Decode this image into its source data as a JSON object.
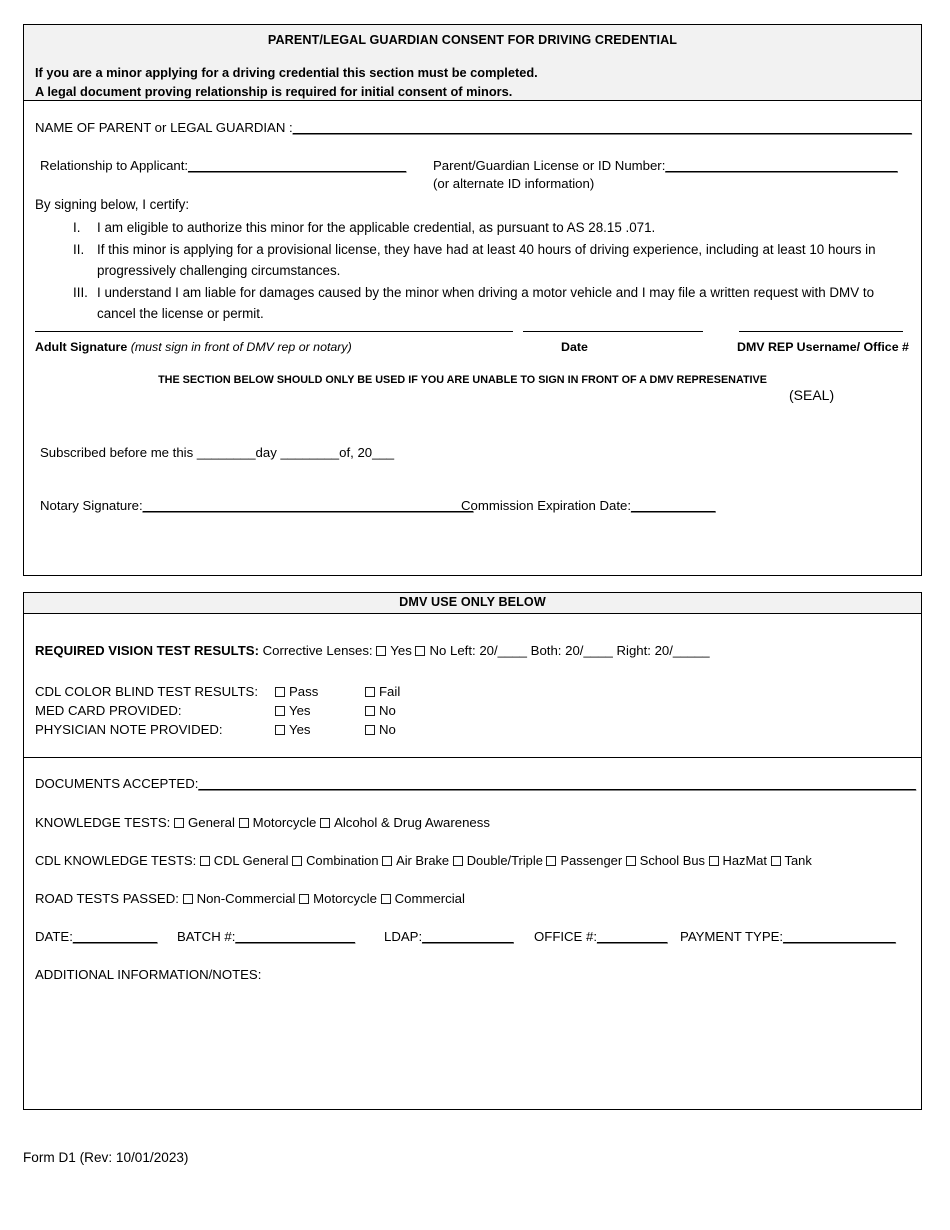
{
  "consent": {
    "title": "PARENT/LEGAL GUARDIAN CONSENT FOR DRIVING CREDENTIAL",
    "notice_line1": "If you are a minor applying for a driving credential this section must be completed.",
    "notice_line2": "A legal document proving relationship is required for initial consent of minors.",
    "name_label": "NAME OF PARENT or  LEGAL GUARDIAN :",
    "name_rule": "________________________________________________________________________________________",
    "relationship_label": "Relationship to Applicant:",
    "relationship_rule": "_______________________________",
    "license_label": "Parent/Guardian License or ID Number:",
    "license_rule": "_________________________________",
    "alternate_id_note": "(or alternate ID information)",
    "certify_intro": "By signing below, I certify:",
    "items": [
      {
        "num": "I.",
        "text": "I am eligible to authorize this minor for the applicable credential, as pursuant to AS 28.15 .071."
      },
      {
        "num": "II.",
        "text": "If this minor is applying for a provisional license, they have had at least 40 hours of driving experience, including at least 10 hours in progressively challenging circumstances."
      },
      {
        "num": "III.",
        "text": "I understand I am liable for damages caused by the minor when driving a motor vehicle and I may file a written request with DMV to cancel the license or permit."
      }
    ],
    "adult_signature_label": "Adult Signature",
    "adult_signature_note": "(must sign in front of DMV rep or notary)",
    "date_label": "Date",
    "dmv_rep_label": "DMV REP Username/ Office #",
    "notary_warning": "THE SECTION BELOW SHOULD ONLY BE USED IF YOU ARE UNABLE TO SIGN IN FRONT OF A DMV REPRESENATIVE",
    "seal_label": "(SEAL)",
    "subscribed_text": "Subscribed before me this ________day ________of, 20___",
    "notary_signature_label": "Notary Signature:",
    "notary_signature_rule": "_______________________________________________",
    "commission_label": "Commission Expiration Date:",
    "commission_rule": "____________"
  },
  "dmv": {
    "title": "DMV USE ONLY BELOW",
    "vision": {
      "heading": "REQUIRED VISION TEST RESULTS",
      "colon": ":",
      "corrective_label": "Corrective Lenses:",
      "corrective_options": [
        "Yes",
        "No"
      ],
      "left_label": "Left: 20/____",
      "both_label": "Both: 20/____",
      "right_label": "Right: 20/_____"
    },
    "checks": [
      {
        "label": "CDL COLOR BLIND TEST RESULTS:",
        "options": [
          "Pass",
          "Fail"
        ]
      },
      {
        "label": "MED CARD PROVIDED:",
        "options": [
          "Yes",
          "No"
        ]
      },
      {
        "label": "PHYSICIAN NOTE PROVIDED:",
        "options": [
          "Yes",
          "No"
        ]
      }
    ],
    "documents_label": "DOCUMENTS ACCEPTED:",
    "documents_rule": "______________________________________________________________________________________________________",
    "knowledge_label": "KNOWLEDGE TESTS:",
    "knowledge_options": [
      "General",
      "Motorcycle",
      "Alcohol & Drug Awareness"
    ],
    "cdl_label": "CDL KNOWLEDGE TESTS:",
    "cdl_options": [
      "CDL General",
      "Combination",
      "Air Brake",
      "Double/Triple",
      "Passenger",
      "School Bus",
      "HazMat",
      "Tank"
    ],
    "road_label": "ROAD TESTS PASSED:",
    "road_options": [
      "Non-Commercial",
      "Motorcycle",
      "Commercial"
    ],
    "meta": [
      {
        "label": "DATE:",
        "rule": "____________"
      },
      {
        "label": "BATCH #:",
        "rule": "_________________"
      },
      {
        "label": "LDAP:",
        "rule": "_____________"
      },
      {
        "label": "OFFICE #:",
        "rule": "__________"
      },
      {
        "label": "PAYMENT TYPE:",
        "rule": "________________"
      }
    ],
    "notes_label": "ADDITIONAL INFORMATION/NOTES:"
  },
  "footer": {
    "form_id": "Form D1 (Rev: 10/01/2023)"
  }
}
